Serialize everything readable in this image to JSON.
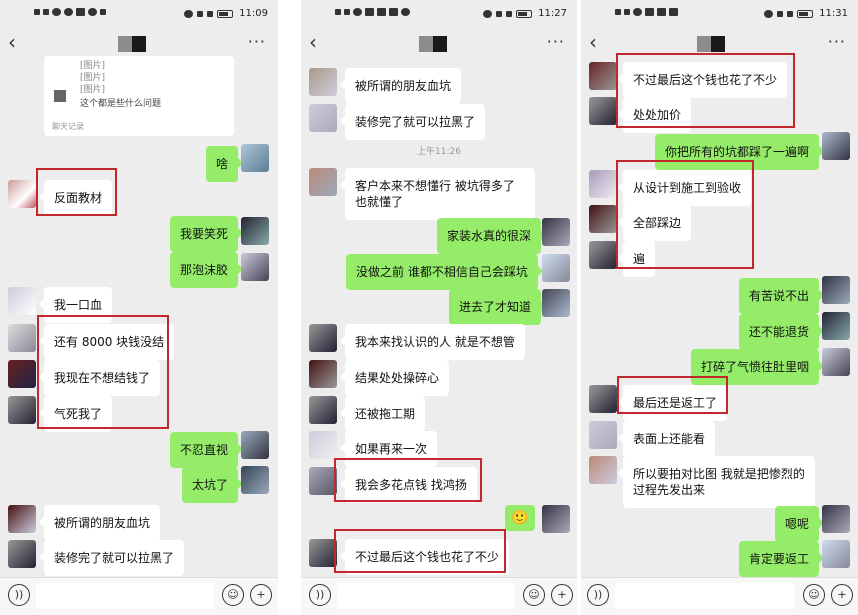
{
  "phone1": {
    "status_time": "11:09",
    "card": {
      "lines": [
        "[图片]",
        "[图片]",
        "[图片]"
      ],
      "question": "这个都是些什么问题",
      "source": "聊天记录"
    },
    "messages": [
      {
        "side": "out",
        "text": "啥"
      },
      {
        "side": "in",
        "text": "反面教材"
      },
      {
        "side": "out",
        "text": "我要笑死"
      },
      {
        "side": "out",
        "text": "那泡沫胶"
      },
      {
        "side": "in",
        "text": "我一口血"
      },
      {
        "side": "in",
        "text": "还有 8000 块钱没结"
      },
      {
        "side": "in",
        "text": "我现在不想结钱了"
      },
      {
        "side": "in",
        "text": "气死我了"
      },
      {
        "side": "out",
        "text": "不忍直视"
      },
      {
        "side": "out",
        "text": "太坑了"
      },
      {
        "side": "in",
        "text": "被所谓的朋友血坑"
      },
      {
        "side": "in",
        "text": "装修完了就可以拉黑了"
      }
    ]
  },
  "phone2": {
    "status_time": "11:27",
    "timestamp": "上午11:26",
    "messages": [
      {
        "side": "in",
        "text": "被所谓的朋友血坑"
      },
      {
        "side": "in",
        "text": "装修完了就可以拉黑了"
      },
      {
        "side": "in",
        "text": "客户本来不想懂行 被坑得多了 也就懂了"
      },
      {
        "side": "out",
        "text": "家装水真的很深"
      },
      {
        "side": "out",
        "text": "没做之前 谁都不相信自己会踩坑"
      },
      {
        "side": "out",
        "text": "进去了才知道"
      },
      {
        "side": "in",
        "text": "我本来找认识的人 就是不想管"
      },
      {
        "side": "in",
        "text": "结果处处操碎心"
      },
      {
        "side": "in",
        "text": "还被拖工期"
      },
      {
        "side": "in",
        "text": "如果再来一次"
      },
      {
        "side": "in",
        "text": "我会多花点钱 找鸿扬"
      },
      {
        "side": "out",
        "text": "🙂"
      },
      {
        "side": "in",
        "text": "不过最后这个钱也花了不少"
      }
    ]
  },
  "phone3": {
    "status_time": "11:31",
    "messages": [
      {
        "side": "in",
        "text": "不过最后这个钱也花了不少"
      },
      {
        "side": "in",
        "text": "处处加价"
      },
      {
        "side": "out",
        "text": "你把所有的坑都踩了一遍啊"
      },
      {
        "side": "in",
        "text": "从设计到施工到验收"
      },
      {
        "side": "in",
        "text": "全部踩边"
      },
      {
        "side": "in",
        "text": "遍"
      },
      {
        "side": "out",
        "text": "有苦说不出"
      },
      {
        "side": "out",
        "text": "还不能退货"
      },
      {
        "side": "out",
        "text": "打碎了气愤往肚里咽"
      },
      {
        "side": "in",
        "text": "最后还是返工了"
      },
      {
        "side": "in",
        "text": "表面上还能看"
      },
      {
        "side": "in",
        "text": "所以要拍对比图 我就是把惨烈的过程先发出来"
      },
      {
        "side": "out",
        "text": "嗯呢"
      },
      {
        "side": "out",
        "text": "肯定要返工"
      }
    ]
  },
  "icons": {
    "back": "chevron-left-icon",
    "more": "more-icon",
    "voice": "voice-icon",
    "emoji": "emoji-icon",
    "plus": "plus-icon"
  },
  "colors": {
    "outgoing_bubble": "#95ec69",
    "incoming_bubble": "#ffffff",
    "background": "#ededed",
    "highlight_box": "#c0282d"
  }
}
